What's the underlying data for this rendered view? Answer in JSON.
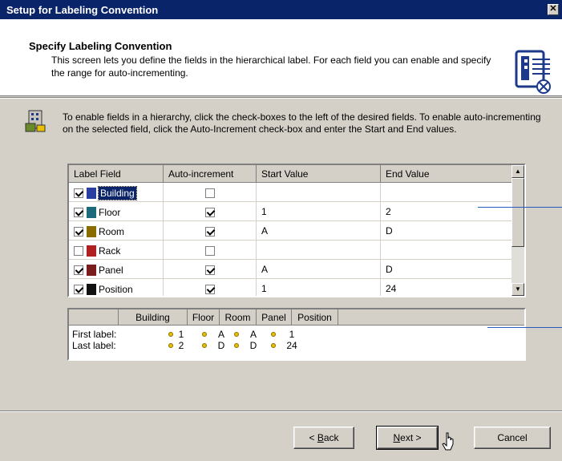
{
  "window": {
    "title": "Setup for Labeling Convention",
    "close_glyph": "✕"
  },
  "header": {
    "title": "Specify Labeling Convention",
    "description": "This screen lets you define the fields in the hierarchical label.  For each field you can enable and specify the range for auto-incrementing.",
    "icon": "label-document-lock-icon"
  },
  "instructions": {
    "icon": "hierarchy-building-icon",
    "text": "To enable fields in a hierarchy, click the check-boxes to the left of the desired fields. To enable auto-incrementing on the selected field, click the Auto-Increment check-box and enter the Start and End values."
  },
  "grid": {
    "columns": [
      "Label Field",
      "Auto-increment",
      "Start Value",
      "End Value"
    ],
    "rows": [
      {
        "field": "Building",
        "enabled": true,
        "auto_increment": false,
        "start": "",
        "end": "",
        "icon_color": "#2a3fa0",
        "selected": true
      },
      {
        "field": "Floor",
        "enabled": true,
        "auto_increment": true,
        "start": "1",
        "end": "2",
        "icon_color": "#1d6b7a",
        "selected": false
      },
      {
        "field": "Room",
        "enabled": true,
        "auto_increment": true,
        "start": "A",
        "end": "D",
        "icon_color": "#8a6d00",
        "selected": false
      },
      {
        "field": "Rack",
        "enabled": false,
        "auto_increment": false,
        "start": "",
        "end": "",
        "icon_color": "#b02020",
        "selected": false
      },
      {
        "field": "Panel",
        "enabled": true,
        "auto_increment": true,
        "start": "A",
        "end": "D",
        "icon_color": "#7a1d1d",
        "selected": false
      },
      {
        "field": "Position",
        "enabled": true,
        "auto_increment": true,
        "start": "1",
        "end": "24",
        "icon_color": "#111111",
        "selected": false
      }
    ],
    "scroll_up": "▲",
    "scroll_down": "▼"
  },
  "preview": {
    "columns": [
      "",
      "Building",
      "Floor",
      "Room",
      "Panel",
      "Position"
    ],
    "first_label": {
      "caption": "First label:",
      "values": [
        "1",
        "A",
        "A",
        "1"
      ]
    },
    "last_label": {
      "caption": "Last label:",
      "values": [
        "2",
        "D",
        "D",
        "24"
      ]
    },
    "separator_color": "#e8c000"
  },
  "buttons": {
    "back": {
      "prefix": "< ",
      "hotkey": "B",
      "rest": "ack"
    },
    "next": {
      "hotkey": "N",
      "rest": "ext >"
    },
    "cancel": "Cancel"
  },
  "colors": {
    "titlebar": "#0a246a",
    "dialog_face": "#d4d0c8",
    "callout_line": "#2a5cc0"
  }
}
